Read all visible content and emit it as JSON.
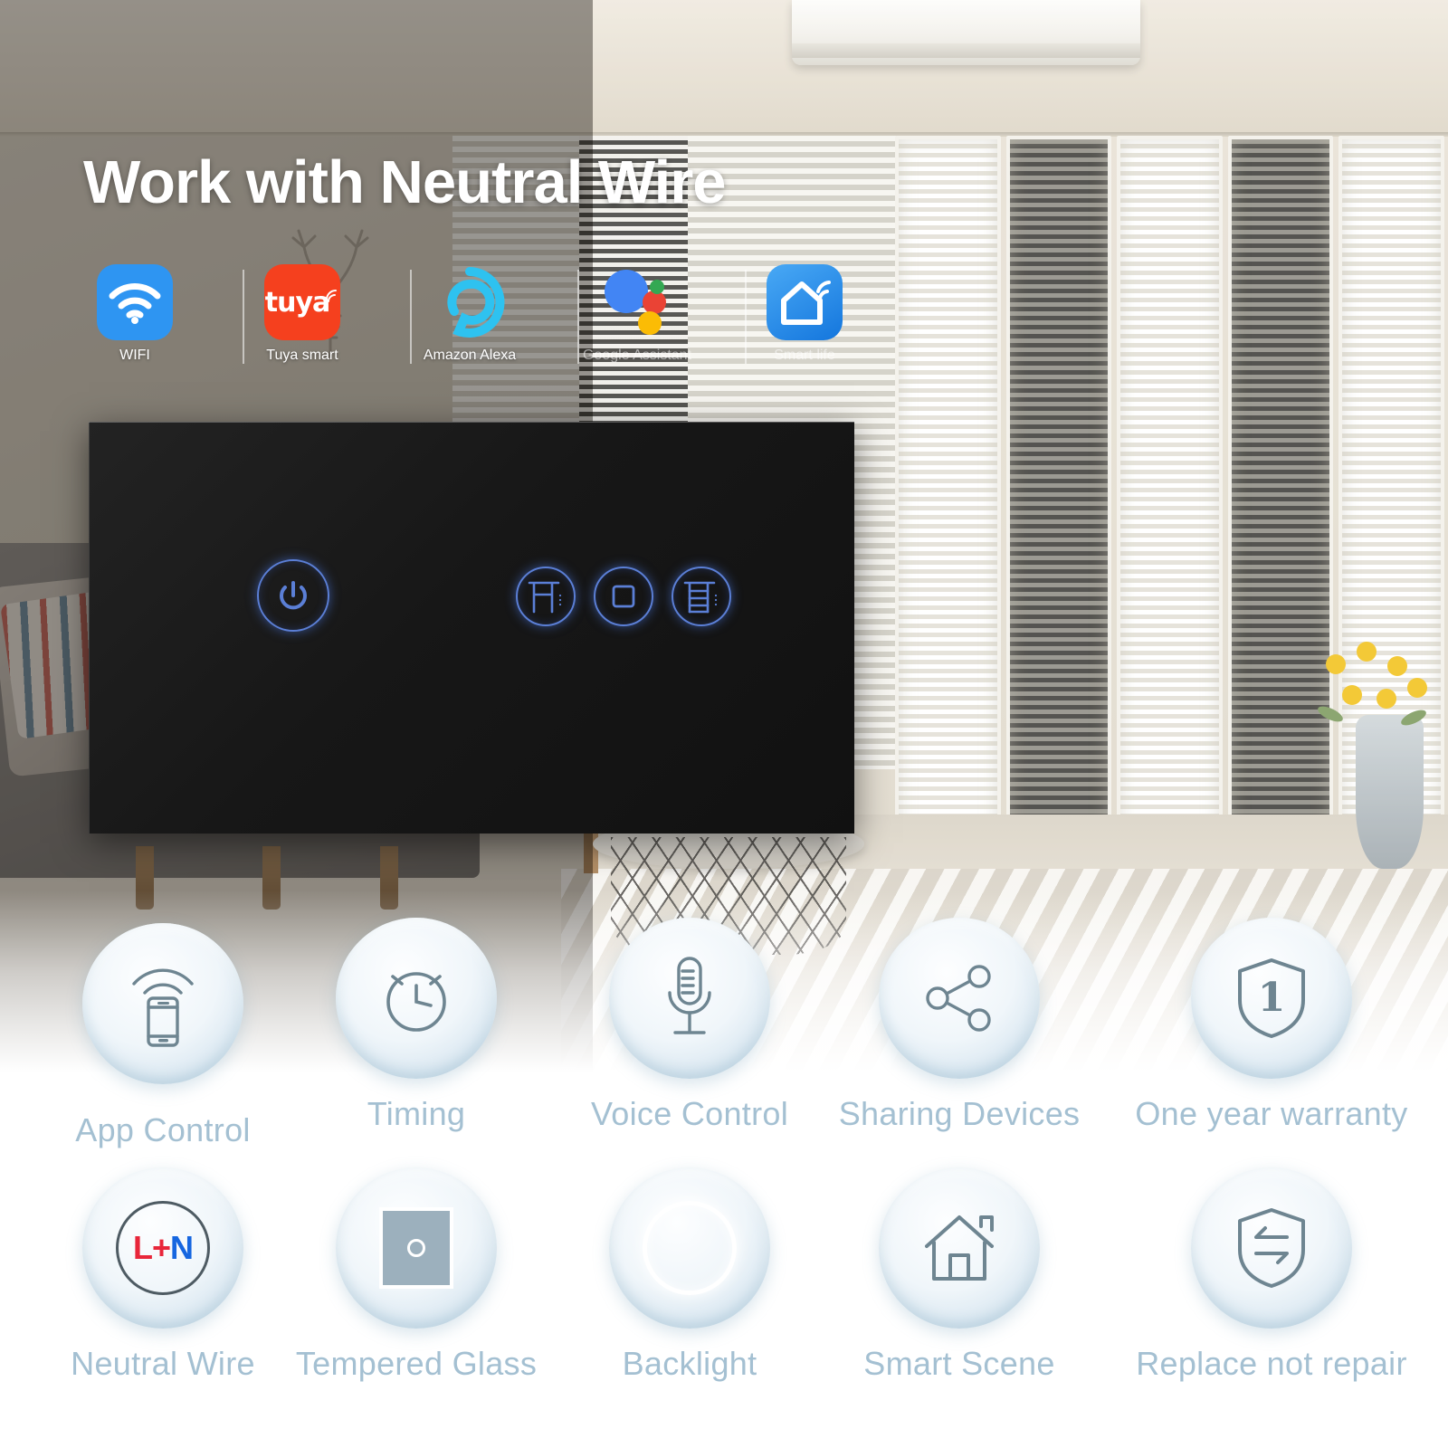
{
  "title": "Work with Neutral Wire",
  "brands": [
    {
      "label": "WIFI",
      "icon": "wifi-icon",
      "color": "#2e95f2"
    },
    {
      "label": "Tuya smart",
      "icon": "tuya-logo-icon",
      "color": "#f5401e"
    },
    {
      "label": "Amazon Alexa",
      "icon": "amazon-alexa-icon",
      "color": "#2ec2f0"
    },
    {
      "label": "Google Assistant",
      "icon": "google-assistant-icon",
      "color": "#4285f4"
    },
    {
      "label": "Smart life",
      "icon": "smart-life-icon",
      "color": "#2e95f2"
    }
  ],
  "brand_colors": {
    "google_blue": "#4285f4",
    "google_red": "#ea4335",
    "google_yellow": "#fbbc05",
    "google_green": "#34a853",
    "alexa_cyan": "#2ec2f0"
  },
  "switch_panel": {
    "face_color": "#171717",
    "led_color": "#5b7fd6",
    "buttons": [
      {
        "name": "power-button",
        "icon": "power-icon"
      },
      {
        "name": "curtain-open-button",
        "icon": "curtain-open-icon"
      },
      {
        "name": "curtain-stop-button",
        "icon": "curtain-stop-icon"
      },
      {
        "name": "curtain-close-button",
        "icon": "curtain-close-icon"
      }
    ]
  },
  "features": {
    "label_color": "#a4c0d2",
    "row1": [
      {
        "label": "App Control",
        "icon": "phone-signal-icon"
      },
      {
        "label": "Timing",
        "icon": "alarm-clock-icon"
      },
      {
        "label": "Voice Control",
        "icon": "microphone-icon"
      },
      {
        "label": "Sharing Devices",
        "icon": "share-nodes-icon"
      },
      {
        "label": "One year warranty",
        "icon": "shield-one-icon",
        "badge": "1"
      }
    ],
    "row2": [
      {
        "label": "Neutral Wire",
        "icon": "l-plus-n-icon",
        "text": "L+N",
        "l": "L",
        "plus": "+",
        "n": "N"
      },
      {
        "label": "Tempered Glass",
        "icon": "glass-panel-icon"
      },
      {
        "label": "Backlight",
        "icon": "backlight-ring-icon"
      },
      {
        "label": "Smart Scene",
        "icon": "house-icon"
      },
      {
        "label": "Replace not repair",
        "icon": "shield-exchange-icon"
      }
    ]
  }
}
